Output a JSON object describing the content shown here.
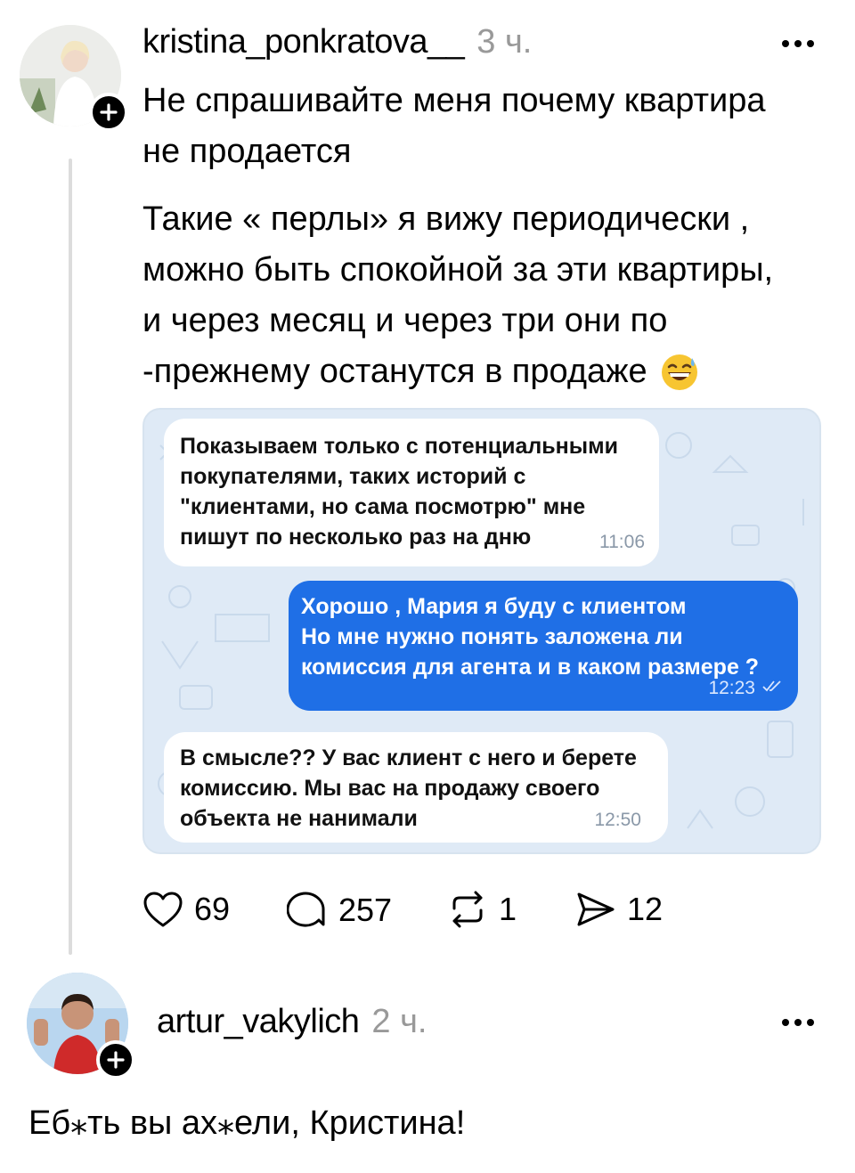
{
  "post": {
    "username": "kristina_ponkratova__",
    "time": "3 ч.",
    "text_lines": [
      "Не спрашивайте меня почему квартира",
      "не продается"
    ],
    "text2_lines": [
      "Такие « перлы» я вижу периодически ,",
      "можно быть спокойной за эти квартиры,",
      "и через месяц и через три они по",
      "-прежнему останутся в продаже"
    ],
    "emoji": "grinning-sweat-emoji",
    "chat": {
      "messages": [
        {
          "direction": "in",
          "lines": [
            "Показываем только с потенциальными",
            "покупателями, таких историй с",
            "\"клиентами, но сама посмотрю\" мне",
            "пишут по несколько раз на дню"
          ],
          "time": "11:06"
        },
        {
          "direction": "out",
          "lines": [
            "Хорошо , Мария я буду с клиентом",
            "Но мне нужно понять заложена ли",
            "комиссия для агента и в каком размере ?"
          ],
          "time": "12:23"
        },
        {
          "direction": "in",
          "lines": [
            "В смысле?? У вас клиент с него и берете",
            "комиссию. Мы вас на продажу своего",
            "объекта не нанимали"
          ],
          "time": "12:50"
        }
      ]
    },
    "actions": {
      "likes": "69",
      "comments": "257",
      "reposts": "1",
      "shares": "12"
    }
  },
  "reply": {
    "username": "artur_vakylich",
    "time": "2 ч.",
    "text": "Еб⁎ть вы ах⁎ели, Кристина!"
  }
}
